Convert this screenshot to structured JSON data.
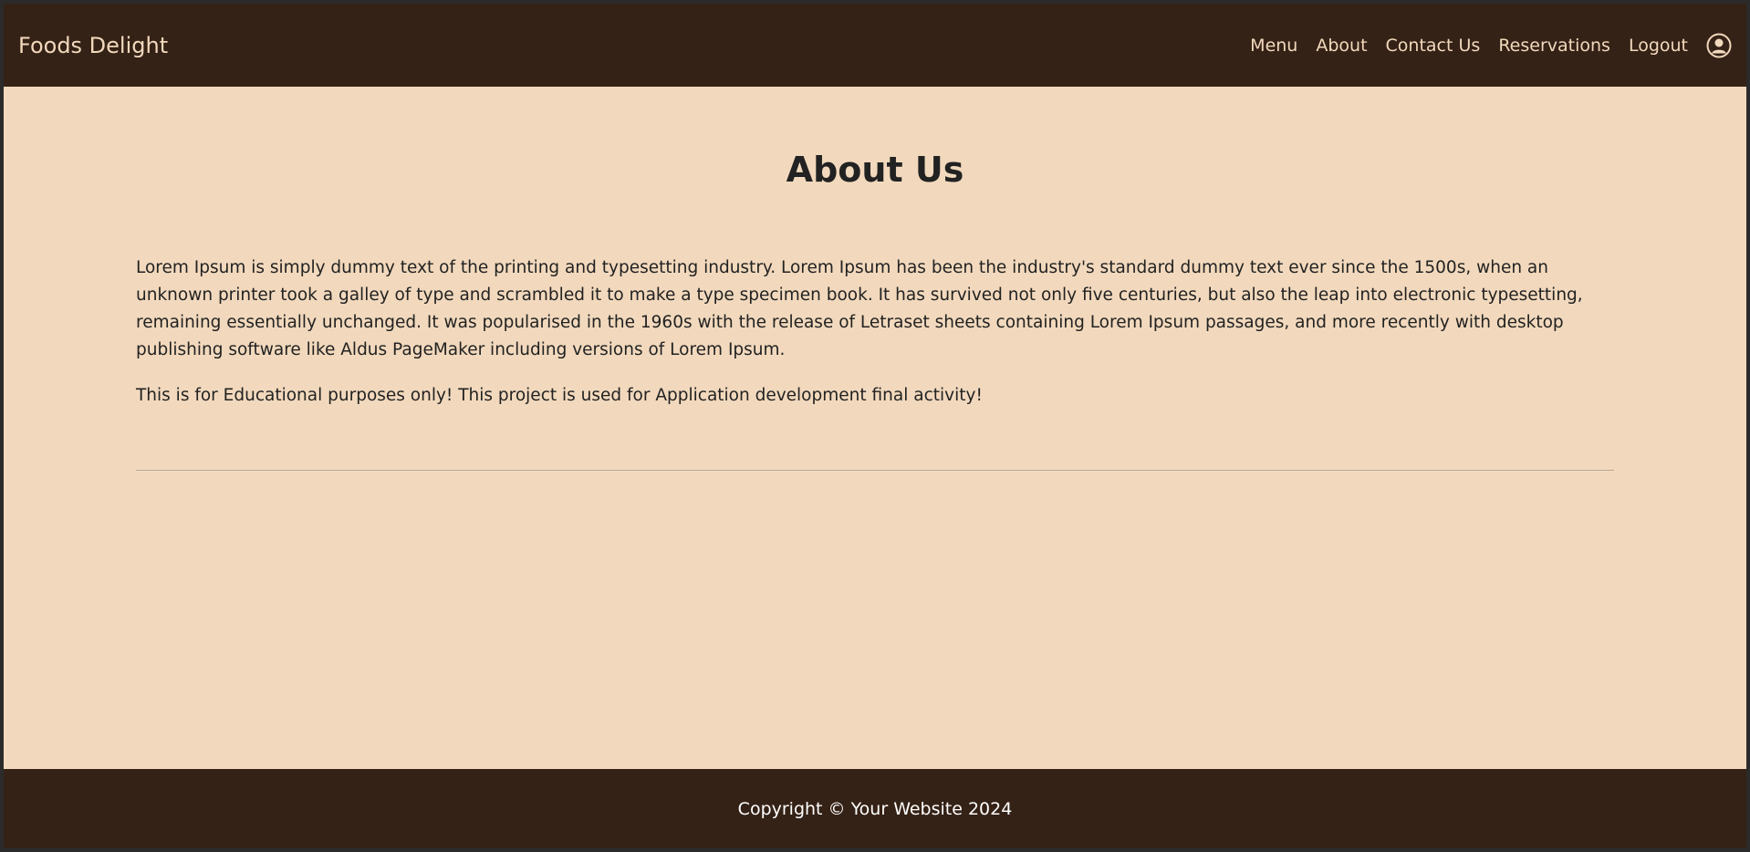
{
  "navbar": {
    "brand": "Foods Delight",
    "links": [
      "Menu",
      "About",
      "Contact Us",
      "Reservations",
      "Logout"
    ],
    "user_icon": "user-circle-icon"
  },
  "main": {
    "title": "About Us",
    "paragraph1": "Lorem Ipsum is simply dummy text of the printing and typesetting industry. Lorem Ipsum has been the industry's standard dummy text ever since the 1500s, when an unknown printer took a galley of type and scrambled it to make a type specimen book. It has survived not only five centuries, but also the leap into electronic typesetting, remaining essentially unchanged. It was popularised in the 1960s with the release of Letraset sheets containing Lorem Ipsum passages, and more recently with desktop publishing software like Aldus PageMaker including versions of Lorem Ipsum.",
    "paragraph2": "This is for Educational purposes only! This project is used for Application development final activity!"
  },
  "footer": {
    "copyright": "Copyright © Your Website 2024"
  },
  "colors": {
    "nav_bg": "#352216",
    "page_bg": "#f2d9bd",
    "nav_text": "#f2d9bd",
    "body_text": "#222222"
  }
}
